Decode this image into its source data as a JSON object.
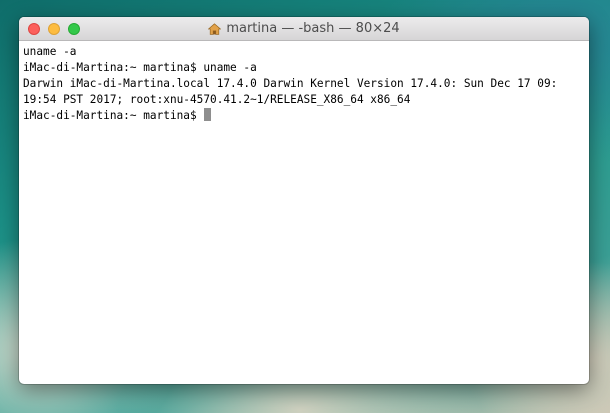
{
  "window": {
    "title": "martina — -bash — 80×24"
  },
  "terminal": {
    "lines": [
      "uname -a",
      "iMac-di-Martina:~ martina$ uname -a",
      "Darwin iMac-di-Martina.local 17.4.0 Darwin Kernel Version 17.4.0: Sun Dec 17 09:",
      "19:54 PST 2017; root:xnu-4570.41.2~1/RELEASE_X86_64 x86_64"
    ],
    "prompt": "iMac-di-Martina:~ martina$ "
  },
  "icons": {
    "title_icon": "home-icon"
  },
  "colors": {
    "close": "#fc605c",
    "minimize": "#fdbc40",
    "zoom": "#34c84a",
    "cursor": "#8e8e8e"
  }
}
